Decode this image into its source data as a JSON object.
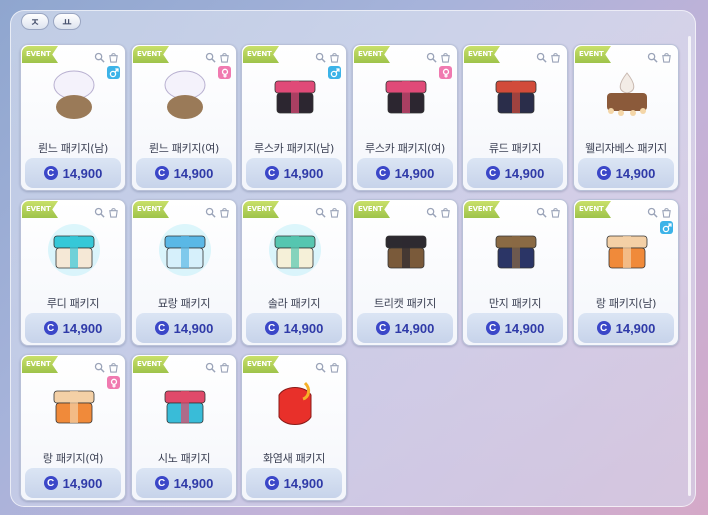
{
  "sort": {
    "asc_label": "ㅈ",
    "desc_label": "ㅛ"
  },
  "accent_price_color": "#2f3aa8",
  "event_label": "EVENT",
  "currency_symbol": "C",
  "items": [
    {
      "name": "륀느 패키지(남)",
      "price": "14,900",
      "gender": "male",
      "art": "wedding-veil",
      "c1": "#e9e4f4",
      "c2": "#9a7a58"
    },
    {
      "name": "륀느 패키지(여)",
      "price": "14,900",
      "gender": "female",
      "art": "wedding-veil",
      "c1": "#e9e4f4",
      "c2": "#9a7a58"
    },
    {
      "name": "루스카 패키지(남)",
      "price": "14,900",
      "gender": "male",
      "art": "dark-box",
      "c1": "#2c2630",
      "c2": "#e04a78"
    },
    {
      "name": "루스카 패키지(여)",
      "price": "14,900",
      "gender": "female",
      "art": "dark-box",
      "c1": "#2c2630",
      "c2": "#e04a78"
    },
    {
      "name": "류드 패키지",
      "price": "14,900",
      "gender": "",
      "art": "ornate-box",
      "c1": "#2a2d4a",
      "c2": "#d24b3a"
    },
    {
      "name": "웰리자베스 패키지",
      "price": "14,900",
      "gender": "",
      "art": "cream-bowl",
      "c1": "#e8dcd2",
      "c2": "#8b5a3a"
    },
    {
      "name": "루디 패키지",
      "price": "14,900",
      "gender": "",
      "art": "teal-box",
      "c1": "#f5e8d6",
      "c2": "#36c8d8"
    },
    {
      "name": "묘랑 패키지",
      "price": "14,900",
      "gender": "",
      "art": "ice-box",
      "c1": "#d6f0fb",
      "c2": "#5ab8e6"
    },
    {
      "name": "솔라 패키지",
      "price": "14,900",
      "gender": "",
      "art": "lantern-box",
      "c1": "#f5f0d8",
      "c2": "#56c6b0"
    },
    {
      "name": "트리캣 패키지",
      "price": "14,900",
      "gender": "",
      "art": "cat-box",
      "c1": "#7a5a3a",
      "c2": "#2d2a30"
    },
    {
      "name": "만지 패키지",
      "price": "14,900",
      "gender": "",
      "art": "navy-box",
      "c1": "#2b3566",
      "c2": "#8a6a44"
    },
    {
      "name": "랑 패키지(남)",
      "price": "14,900",
      "gender": "male",
      "art": "orange-box",
      "c1": "#f08a3a",
      "c2": "#f4d0a6"
    },
    {
      "name": "랑 패키지(여)",
      "price": "14,900",
      "gender": "female",
      "art": "orange-box",
      "c1": "#f08a3a",
      "c2": "#f4d0a6"
    },
    {
      "name": "시노 패키지",
      "price": "14,900",
      "gender": "",
      "art": "cyan-box",
      "c1": "#39bcd8",
      "c2": "#e04a6a"
    },
    {
      "name": "화염새 패키지",
      "price": "14,900",
      "gender": "",
      "art": "fire-box",
      "c1": "#e8302a",
      "c2": "#f6b028"
    }
  ]
}
